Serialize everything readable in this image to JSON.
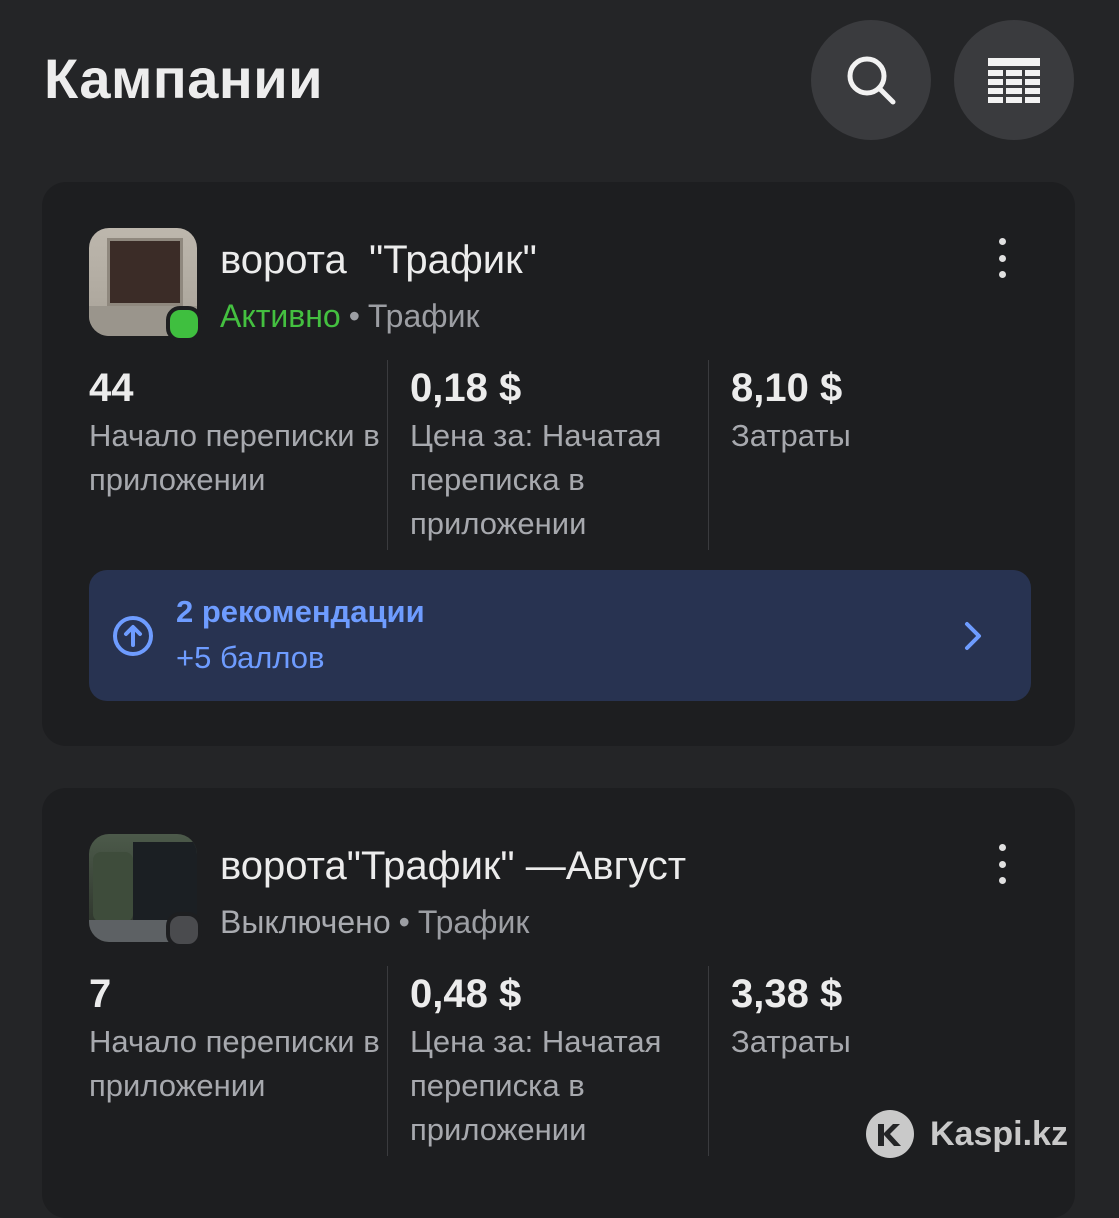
{
  "header": {
    "title": "Кампании",
    "search_icon": "search-icon",
    "table_icon": "table-columns-icon"
  },
  "campaigns": [
    {
      "name": "ворота  \"Трафик\"",
      "status": "Активно",
      "status_color": "#3fbf3f",
      "objective": "Трафик",
      "metrics": [
        {
          "value": "44",
          "label": "Начало переписки в приложении"
        },
        {
          "value": "0,18 $",
          "label": "Цена за: Начатая переписка в приложении"
        },
        {
          "value": "8,10 $",
          "label": "Затраты"
        }
      ],
      "recommendation": {
        "title": "2 рекомендации",
        "subtitle": "+5 баллов",
        "icon": "arrow-up-circle-icon"
      }
    },
    {
      "name": "ворота\"Трафик\" —Август",
      "status": "Выключено",
      "status_color": "#4a4b4e",
      "objective": "Трафик",
      "metrics": [
        {
          "value": "7",
          "label": "Начало переписки в приложении"
        },
        {
          "value": "0,48 $",
          "label": "Цена за: Начатая переписка в приложении"
        },
        {
          "value": "3,38 $",
          "label": "Затраты"
        }
      ]
    }
  ],
  "separator": "•",
  "watermark": "Kaspi.kz",
  "colors": {
    "background": "#242527",
    "card": "#1d1e20",
    "accent_blue": "#6e9cff",
    "recommend_bg": "#283351",
    "active_green": "#44c040"
  }
}
